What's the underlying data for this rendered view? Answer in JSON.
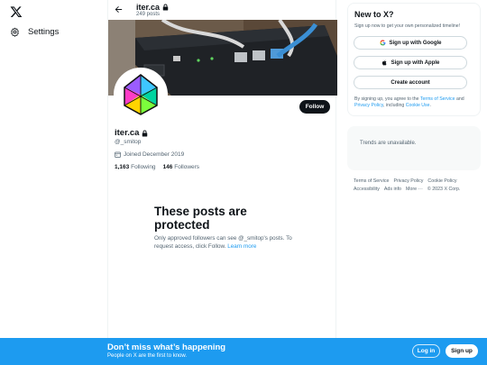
{
  "left_nav": {
    "settings_label": "Settings"
  },
  "header": {
    "name": "iter.ca",
    "post_count": "249 posts"
  },
  "profile": {
    "name": "iter.ca",
    "handle": "@_smitop",
    "joined": "Joined December 2019",
    "following_count": "1,163",
    "following_label": "Following",
    "followers_count": "146",
    "followers_label": "Followers",
    "follow_label": "Follow"
  },
  "protected": {
    "title": "These posts are protected",
    "text": "Only approved followers can see @_smitop's posts. To request access, click Follow.",
    "link": "Learn more"
  },
  "signup_box": {
    "title": "New to X?",
    "subtitle": "Sign up now to get your own personalized timeline!",
    "google_label": "Sign up with Google",
    "apple_label": "Sign up with Apple",
    "create_label": "Create account",
    "terms_prefix": "By signing up, you agree to the ",
    "terms_link": "Terms of Service",
    "terms_and": " and ",
    "privacy_link": "Privacy Policy",
    "terms_mid": ", including ",
    "cookie_link": "Cookie Use",
    "terms_end": "."
  },
  "trends": {
    "text": "Trends are unavailable."
  },
  "footer": {
    "links": [
      "Terms of Service",
      "Privacy Policy",
      "Cookie Policy",
      "Accessibility",
      "Ads info",
      "More ···",
      "© 2023 X Corp."
    ]
  },
  "bottom_bar": {
    "title": "Don’t miss what’s happening",
    "subtitle": "People on X are the first to know.",
    "login_label": "Log in",
    "signup_label": "Sign up"
  },
  "colors": {
    "accent": "#1d9bf0",
    "text": "#0f1419",
    "muted": "#536471"
  },
  "icons": [
    "x-logo-icon",
    "gear-icon",
    "back-arrow-icon",
    "lock-icon",
    "calendar-icon",
    "google-icon",
    "apple-icon"
  ]
}
